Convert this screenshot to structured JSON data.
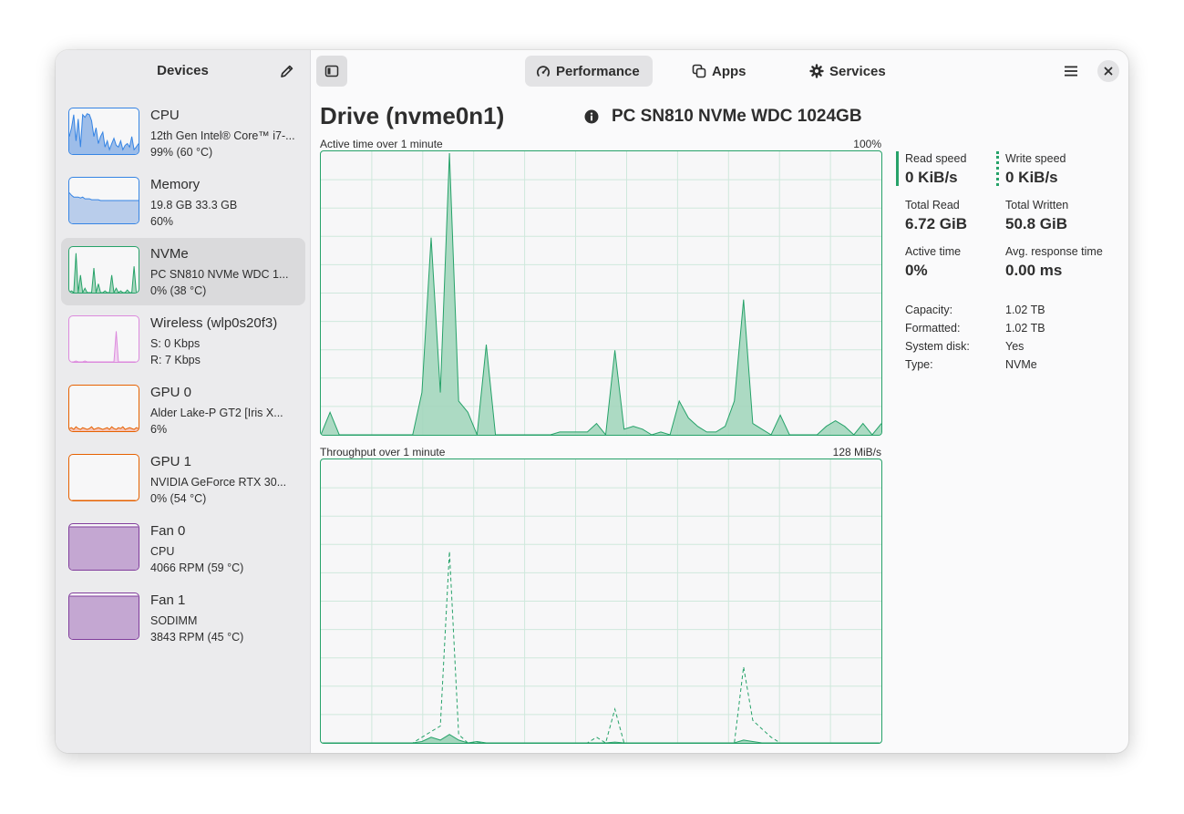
{
  "sidebar": {
    "title": "Devices",
    "edit_icon": "pencil-icon",
    "devices": [
      {
        "name": "CPU",
        "line1": "12th Gen Intel® Core™ i7-...",
        "line2": "99% (60 °C)",
        "color": "#3584e4",
        "fill": "#9dbde9"
      },
      {
        "name": "Memory",
        "line1": "19.8 GB 33.3 GB",
        "line2": "60%",
        "color": "#3584e4",
        "fill": "#b9cdeb"
      },
      {
        "name": "NVMe",
        "line1": "PC SN810 NVMe WDC 1...",
        "line2": "0% (38 °C)",
        "color": "#26a269",
        "fill": "#a9d7bf",
        "selected": true
      },
      {
        "name": "Wireless (wlp0s20f3)",
        "line1": "S: 0 Kbps",
        "line2": "R: 7 Kbps",
        "color": "#dc8add",
        "fill": "#f0d2f0"
      },
      {
        "name": "GPU 0",
        "line1": "Alder Lake-P GT2 [Iris X...",
        "line2": "6%",
        "color": "#e66100",
        "fill": "#f5c2b5"
      },
      {
        "name": "GPU 1",
        "line1": "NVIDIA GeForce RTX 30...",
        "line2": "0% (54 °C)",
        "color": "#e66100",
        "fill": "#f5c2b5"
      },
      {
        "name": "Fan 0",
        "line1": "CPU",
        "line2": "4066 RPM (59 °C)",
        "color": "#813d9c",
        "fill": "#c4a7d2"
      },
      {
        "name": "Fan 1",
        "line1": "SODIMM",
        "line2": "3843 RPM (45 °C)",
        "color": "#813d9c",
        "fill": "#c4a7d2"
      }
    ]
  },
  "header": {
    "toggle_icon": "sidebar-toggle-icon",
    "tabs": [
      {
        "label": "Performance",
        "icon": "speedometer-icon",
        "active": true
      },
      {
        "label": "Apps",
        "icon": "apps-icon",
        "active": false
      },
      {
        "label": "Services",
        "icon": "gear-icon",
        "active": false
      }
    ],
    "menu_icon": "hamburger-menu-icon",
    "close_icon": "close-icon"
  },
  "drive": {
    "title": "Drive (nvme0n1)",
    "model": "PC SN810 NVMe WDC 1024GB",
    "accent": "#26a269"
  },
  "charts": {
    "active": {
      "label": "Active time over 1 minute",
      "max_label": "100%",
      "values": [
        0,
        8,
        0,
        0,
        0,
        0,
        0,
        0,
        0,
        0,
        0,
        15,
        70,
        15,
        100,
        12,
        8,
        0,
        32,
        0,
        0,
        0,
        0,
        0,
        0,
        0,
        1,
        1,
        1,
        1,
        4,
        0,
        30,
        2,
        3,
        2,
        0,
        1,
        0,
        12,
        6,
        3,
        1,
        1,
        3,
        12,
        48,
        4,
        2,
        0,
        7,
        0,
        0,
        0,
        0,
        3,
        5,
        3,
        0,
        4,
        0,
        4
      ]
    },
    "throughput": {
      "label": "Throughput over 1 minute",
      "max_label": "128 MiB/s",
      "read_values": [
        0,
        0,
        0,
        0,
        0,
        0,
        0,
        0,
        0,
        0,
        0,
        0.5,
        2,
        1,
        3,
        1,
        0,
        0.5,
        0,
        0,
        0,
        0,
        0,
        0,
        0,
        0,
        0,
        0,
        0,
        0,
        0,
        0,
        0.3,
        0,
        0,
        0,
        0,
        0,
        0,
        0,
        0,
        0,
        0,
        0,
        0,
        0,
        1,
        0.5,
        0,
        0,
        0,
        0,
        0,
        0,
        0,
        0,
        0,
        0,
        0,
        0,
        0,
        0
      ],
      "write_values": [
        0,
        0,
        0,
        0,
        0,
        0,
        0,
        0,
        0,
        0,
        0,
        2,
        4,
        6,
        68,
        3,
        0,
        0,
        0,
        0,
        0,
        0,
        0,
        0,
        0,
        0,
        0,
        0,
        0,
        0,
        2,
        0,
        12,
        0,
        0,
        0,
        0,
        0,
        0,
        0,
        0,
        0,
        0,
        0,
        0,
        0,
        27,
        8,
        5,
        2,
        0,
        0,
        0,
        0,
        0,
        0,
        0,
        0,
        0,
        0,
        0,
        0
      ]
    }
  },
  "stats": {
    "read_speed_label": "Read speed",
    "read_speed": "0 KiB/s",
    "write_speed_label": "Write speed",
    "write_speed": "0 KiB/s",
    "total_read_label": "Total Read",
    "total_read": "6.72 GiB",
    "total_written_label": "Total Written",
    "total_written": "50.8 GiB",
    "active_time_label": "Active time",
    "active_time": "0%",
    "avg_response_label": "Avg. response time",
    "avg_response": "0.00 ms"
  },
  "details": [
    {
      "key": "Capacity:",
      "value": "1.02 TB"
    },
    {
      "key": "Formatted:",
      "value": "1.02 TB"
    },
    {
      "key": "System disk:",
      "value": "Yes"
    },
    {
      "key": "Type:",
      "value": "NVMe"
    }
  ]
}
